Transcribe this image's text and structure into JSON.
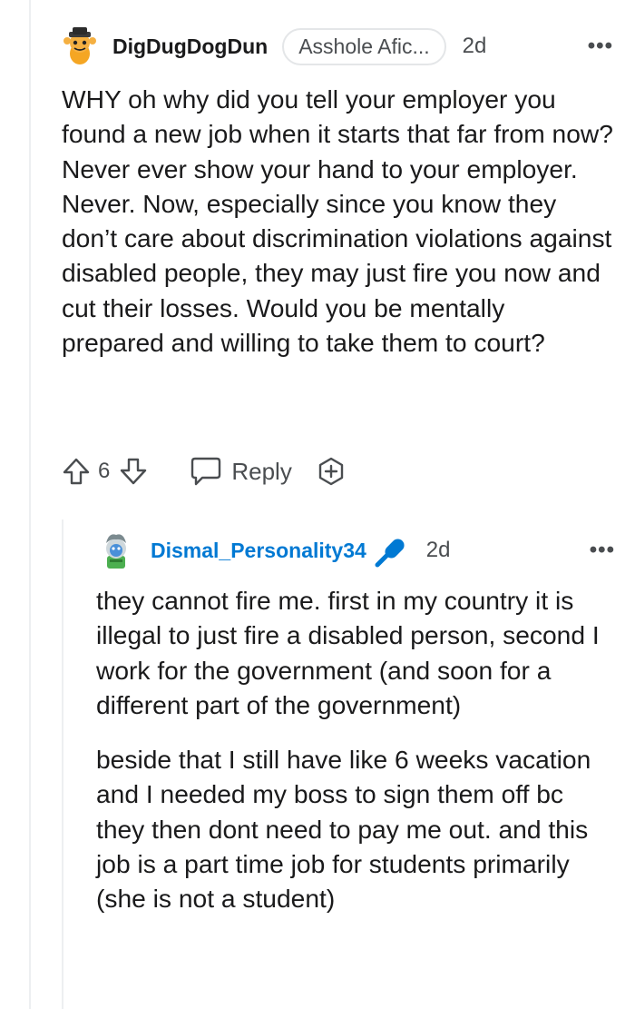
{
  "comment": {
    "username": "DigDugDogDun",
    "flair": "Asshole Afic...",
    "age": "2d",
    "more": "•••",
    "body": "WHY oh why did you tell your employer you found a new job when it starts that far from now? Never ever show your hand to your employer. Never. Now, especially since you know they don’t care about discrimination violations against disabled people, they may just fire you now and cut their losses. Would you be mentally prepared and willing to take them to court?",
    "score": "6",
    "reply_label": "Reply",
    "icons": [
      "upvote-icon",
      "downvote-icon",
      "reply-icon",
      "award-icon",
      "more-options-icon"
    ]
  },
  "reply": {
    "username": "Dismal_Personality34",
    "age": "2d",
    "more": "•••",
    "paragraphs": [
      "they cannot fire me. first in my country it is illegal to just fire a disabled person, second I work for the government (and soon for a different part of the government)",
      "beside that I still have like 6 weeks vacation and I needed my boss to sign them off bc they then dont need to pay me out. and this job is a part time job for students primarily (she is not a student)"
    ],
    "badge_icon": "op-microphone-icon",
    "username_color": "#0079d3"
  }
}
